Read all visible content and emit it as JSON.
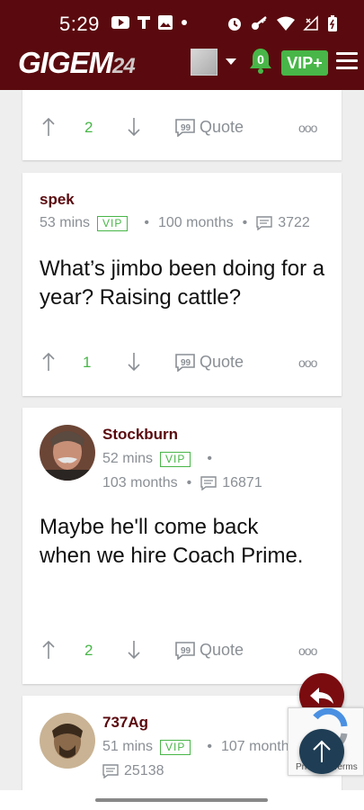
{
  "status_bar": {
    "time": "5:29",
    "left_icons": [
      "youtube-icon",
      "t-app-icon",
      "image-icon",
      "dot-icon"
    ],
    "right_icons": [
      "alarm-icon",
      "key-icon",
      "wifi-icon",
      "no-signal-icon",
      "battery-icon"
    ]
  },
  "header": {
    "logo_text": "GIGEM",
    "logo_suffix": "24",
    "notifications_count": "0",
    "vip_label": "VIP+",
    "colors": {
      "brand": "#5a0a0e",
      "accent_green": "#48b648"
    }
  },
  "posts": [
    {
      "score": "2",
      "quote_label": "Quote",
      "more_label": "ooo"
    },
    {
      "username": "spek",
      "time_ago": "53 mins",
      "vip_badge": "VIP",
      "member_for": "100 months",
      "post_count": "3722",
      "body": "What’s jimbo been doing for a year? Raising cattle?",
      "score": "1",
      "quote_label": "Quote",
      "more_label": "ooo"
    },
    {
      "username": "Stockburn",
      "time_ago": "52 mins",
      "vip_badge": "VIP",
      "member_for": "103 months",
      "post_count": "16871",
      "body": "Maybe he'll come back when we hire Coach Prime.",
      "score": "2",
      "quote_label": "Quote",
      "more_label": "ooo"
    },
    {
      "username": "737Ag",
      "time_ago": "51 mins",
      "vip_badge": "VIP",
      "member_for": "107 months",
      "post_count": "25138"
    }
  ],
  "recaptcha": {
    "text": "Privacy - Terms"
  }
}
